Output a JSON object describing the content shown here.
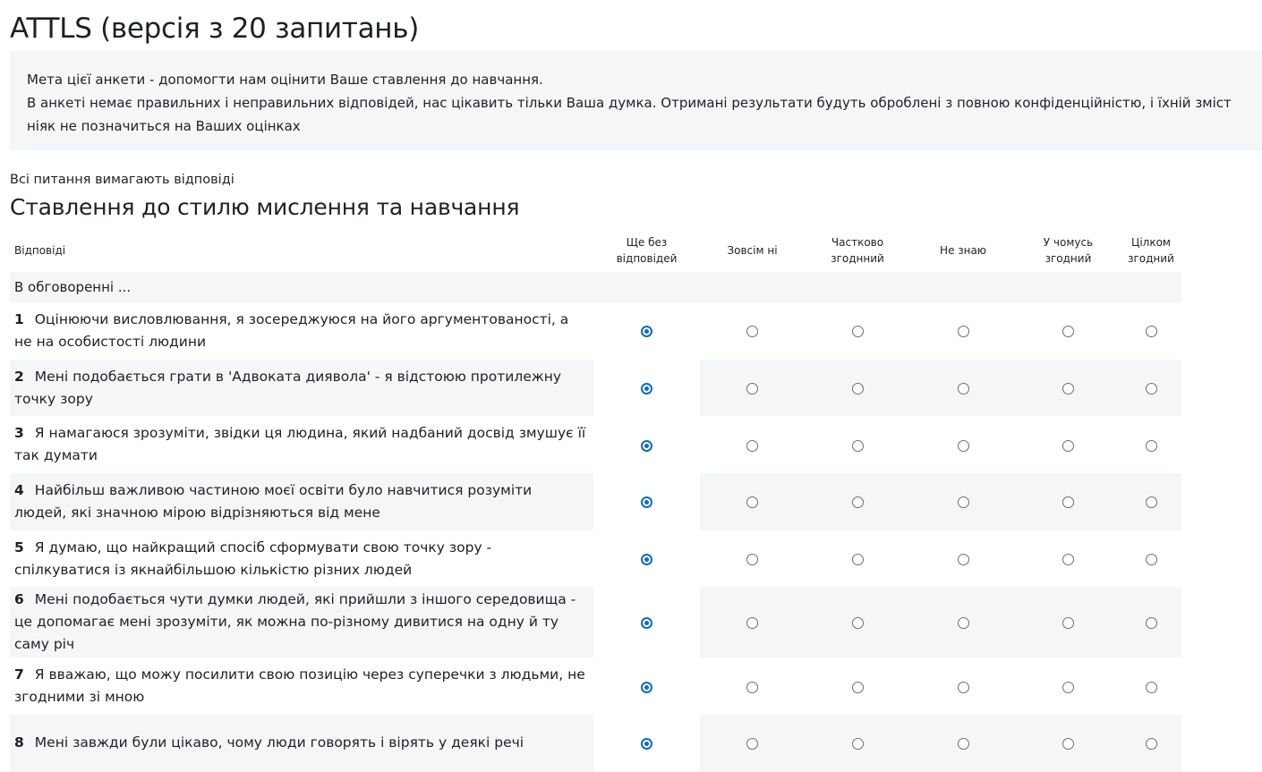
{
  "page": {
    "title": "ATTLS (версія з 20 запитань)",
    "intro_line1": "Мета цієї анкети - допомогти нам оцінити Ваше ставлення до навчання.",
    "intro_line2": "В анкеті немає правильних і неправильних відповідей, нас цікавить тільки Ваша думка. Отримані результати будуть оброблені з повною конфіденційністю, і їхній зміст ніяк не позначиться на Ваших оцінках",
    "required_note": "Всі питання вимагають відповіді",
    "section_title": "Ставлення до стилю мислення та навчання"
  },
  "table": {
    "headers": {
      "responses": "Відповіді",
      "no_answer": "Ще без відповідей",
      "strongly_disagree": "Зовсім ні",
      "partly_agree": "Частково згоднний",
      "dont_know": "Не знаю",
      "somewhat_agree": "У чомусь згодний",
      "fully_agree": "Цілком згодний"
    },
    "group_label": "В обговоренні ...",
    "questions": [
      {
        "num": "1",
        "text": "Оцінюючи висловлювання, я зосереджуюся на його аргументованості, а не на особистості людини"
      },
      {
        "num": "2",
        "text": "Мені подобається грати в 'Адвоката диявола' - я відстоюю протилежну точку зору"
      },
      {
        "num": "3",
        "text": "Я намагаюся зрозуміти, звідки ця людина, який надбаний досвід змушує її так думати"
      },
      {
        "num": "4",
        "text": "Найбільш важливою частиною моєї освіти було навчитися розуміти людей, які значною мірою відрізняються від мене"
      },
      {
        "num": "5",
        "text": "Я думаю, що найкращий спосіб сформувати свою точку зору - спілкуватися із якнайбільшою кількістю різних людей"
      },
      {
        "num": "6",
        "text": "Мені подобається чути думки людей, які прийшли з іншого середовища - це допомагає мені зрозуміти, як можна по-різному дивитися на одну й ту саму річ"
      },
      {
        "num": "7",
        "text": "Я вважаю, що можу посилити свою позицію через суперечки з людьми, не згодними зі мною"
      },
      {
        "num": "8",
        "text": "Мені завжди були цікаво, чому люди говорять і вірять у деякі речі"
      }
    ]
  },
  "colors": {
    "accent": "#0f6cbf",
    "shade": "#f5f6f8"
  }
}
